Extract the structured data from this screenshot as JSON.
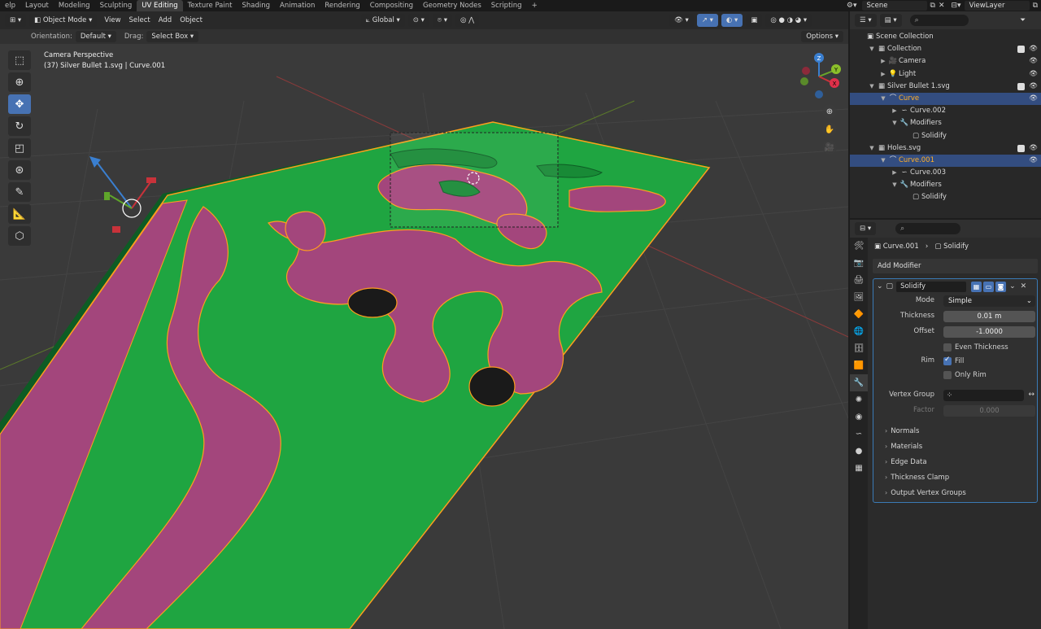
{
  "workspaces": [
    "elp",
    "Layout",
    "Modeling",
    "Sculpting",
    "UV Editing",
    "Texture Paint",
    "Shading",
    "Animation",
    "Rendering",
    "Compositing",
    "Geometry Nodes",
    "Scripting",
    "+"
  ],
  "active_workspace_index": 4,
  "scene_name": "Scene",
  "viewlayer_name": "ViewLayer",
  "viewport": {
    "mode": "Object Mode",
    "menus": [
      "View",
      "Select",
      "Add",
      "Object"
    ],
    "transform_orientation": "Global",
    "orientation_label": "Orientation:",
    "orientation_value": "Default",
    "drag_label": "Drag:",
    "drag_value": "Select Box",
    "options_label": "Options",
    "info_line1": "Camera Perspective",
    "info_line2": "(37) Silver Bullet 1.svg | Curve.001",
    "axis_x": "X",
    "axis_y": "Y",
    "axis_z": "Z",
    "colors": {
      "green": "#1fa541",
      "pink": "#a3467c",
      "outline": "#ff9d1e",
      "grid_bg": "#3a3a3a"
    }
  },
  "outliner": {
    "rows": [
      {
        "name": "Scene Collection",
        "indent": 0,
        "icon": "▣",
        "twist": "",
        "eye": false,
        "check": false,
        "sel": false,
        "active": false
      },
      {
        "name": "Collection",
        "indent": 1,
        "icon": "▦",
        "twist": "▼",
        "eye": true,
        "check": true,
        "sel": false,
        "active": false
      },
      {
        "name": "Camera",
        "indent": 2,
        "icon": "🎥",
        "twist": "▶",
        "eye": true,
        "check": false,
        "sel": false,
        "active": false
      },
      {
        "name": "Light",
        "indent": 2,
        "icon": "💡",
        "twist": "▶",
        "eye": true,
        "check": false,
        "sel": false,
        "active": false
      },
      {
        "name": "Silver Bullet 1.svg",
        "indent": 1,
        "icon": "▦",
        "twist": "▼",
        "eye": true,
        "check": true,
        "sel": false,
        "active": false
      },
      {
        "name": "Curve",
        "indent": 2,
        "icon": "⌒",
        "twist": "▼",
        "eye": true,
        "check": false,
        "sel": true,
        "active": true
      },
      {
        "name": "Curve.002",
        "indent": 3,
        "icon": "∽",
        "twist": "▶",
        "eye": false,
        "check": false,
        "sel": false,
        "active": false
      },
      {
        "name": "Modifiers",
        "indent": 3,
        "icon": "🔧",
        "twist": "▼",
        "eye": false,
        "check": false,
        "sel": false,
        "active": false
      },
      {
        "name": "Solidify",
        "indent": 4,
        "icon": "▢",
        "twist": "",
        "eye": false,
        "check": false,
        "sel": false,
        "active": false
      },
      {
        "name": "Holes.svg",
        "indent": 1,
        "icon": "▦",
        "twist": "▼",
        "eye": true,
        "check": true,
        "sel": false,
        "active": false
      },
      {
        "name": "Curve.001",
        "indent": 2,
        "icon": "⌒",
        "twist": "▼",
        "eye": true,
        "check": false,
        "sel": true,
        "active": true
      },
      {
        "name": "Curve.003",
        "indent": 3,
        "icon": "∽",
        "twist": "▶",
        "eye": false,
        "check": false,
        "sel": false,
        "active": false
      },
      {
        "name": "Modifiers",
        "indent": 3,
        "icon": "🔧",
        "twist": "▼",
        "eye": false,
        "check": false,
        "sel": false,
        "active": false
      },
      {
        "name": "Solidify",
        "indent": 4,
        "icon": "▢",
        "twist": "",
        "eye": false,
        "check": false,
        "sel": false,
        "active": false
      }
    ]
  },
  "properties": {
    "breadcrumb_object": "Curve.001",
    "breadcrumb_modifier": "Solidify",
    "add_modifier": "Add Modifier",
    "modifier_name": "Solidify",
    "mode_label": "Mode",
    "mode_value": "Simple",
    "thickness_label": "Thickness",
    "thickness_value": "0.01 m",
    "offset_label": "Offset",
    "offset_value": "-1.0000",
    "even_thickness_label": "Even Thickness",
    "rim_label": "Rim",
    "fill_label": "Fill",
    "only_rim_label": "Only Rim",
    "vertex_group_label": "Vertex Group",
    "factor_label": "Factor",
    "factor_value": "0.000",
    "subpanels": [
      "Normals",
      "Materials",
      "Edge Data",
      "Thickness Clamp",
      "Output Vertex Groups"
    ]
  }
}
